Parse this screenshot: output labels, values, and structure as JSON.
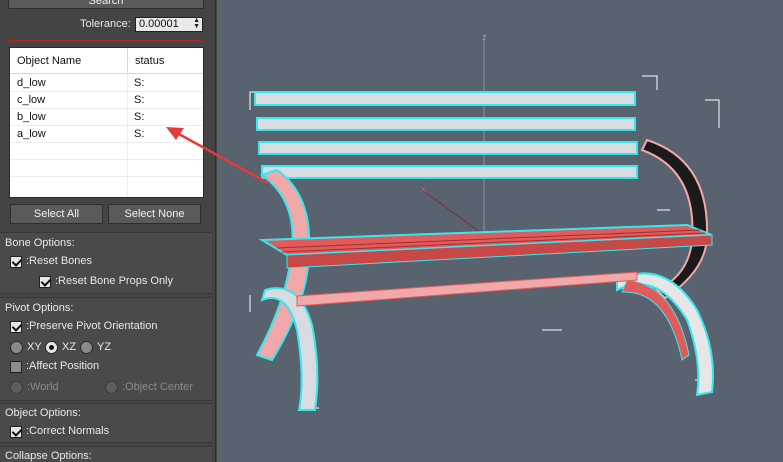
{
  "search_button": "Search",
  "tolerance": {
    "label": "Tolerance:",
    "value": "0.00001"
  },
  "object_list": {
    "columns": [
      "Object Name",
      "status"
    ],
    "rows": [
      {
        "name": "d_low",
        "status": "S:"
      },
      {
        "name": "c_low",
        "status": "S:"
      },
      {
        "name": "b_low",
        "status": "S:"
      },
      {
        "name": "a_low",
        "status": "S:"
      }
    ]
  },
  "buttons": {
    "select_all": "Select All",
    "select_none": "Select None"
  },
  "bone_options": {
    "title": "Bone Options:",
    "reset_bones": {
      "label": ":Reset Bones",
      "checked": true
    },
    "reset_bone_props": {
      "label": ":Reset Bone Props Only",
      "checked": true
    }
  },
  "pivot_options": {
    "title": "Pivot Options:",
    "preserve_orientation": {
      "label": ":Preserve Pivot Orientation",
      "checked": true
    },
    "axes": [
      {
        "label": "XY",
        "selected": false
      },
      {
        "label": "XZ",
        "selected": true
      },
      {
        "label": "YZ",
        "selected": false
      }
    ],
    "affect_position": {
      "label": ":Affect Position",
      "checked": false
    },
    "world": ":World",
    "object_center": ":Object Center"
  },
  "object_options": {
    "title": "Object Options:",
    "correct_normals": {
      "label": ":Correct Normals",
      "checked": true
    }
  },
  "collapse_options": {
    "title": "Collapse Options:"
  },
  "viewport": {
    "axis_z": "z",
    "axis_x": "x"
  },
  "colors": {
    "panel_bg": "#444444",
    "viewport_bg": "#59626f",
    "highlight_cyan": "#35e8f0",
    "model_red": "#e25a5a",
    "annotation_arrow": "#e33a3a"
  }
}
